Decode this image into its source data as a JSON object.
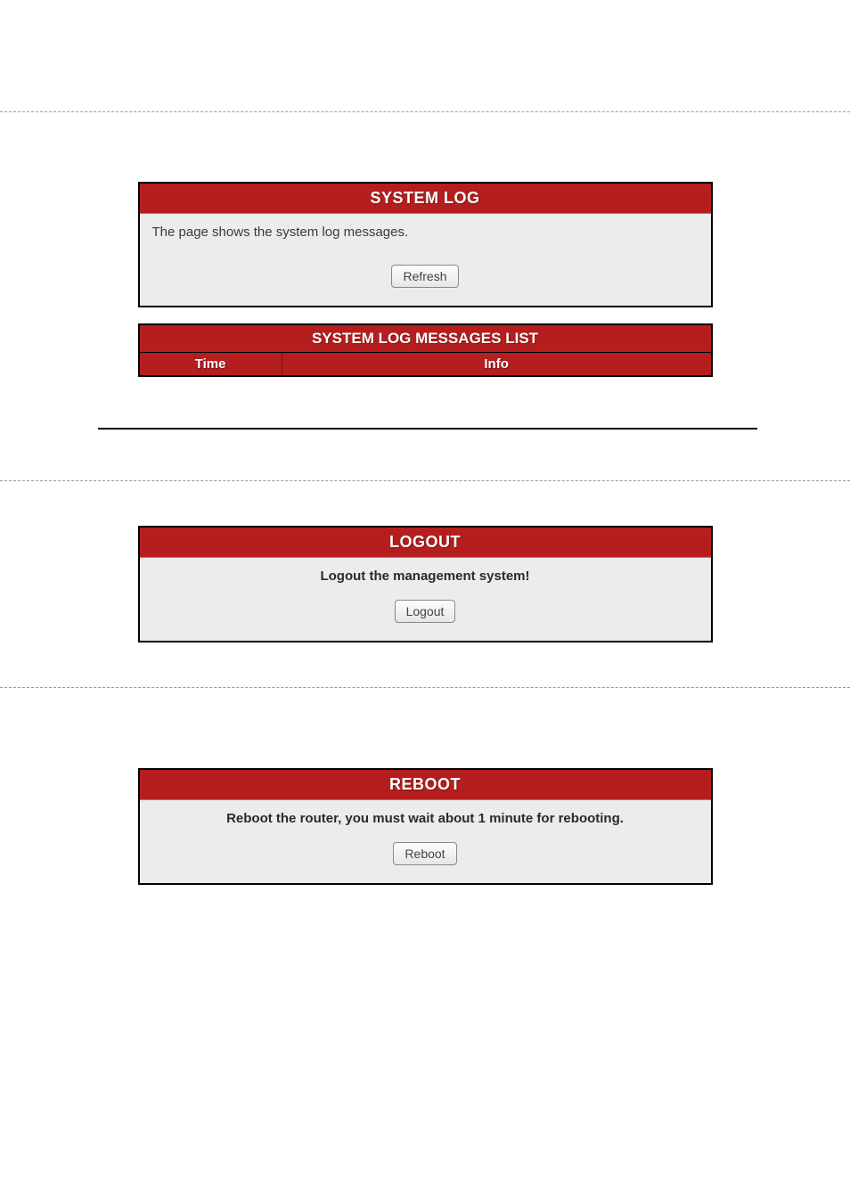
{
  "system_log": {
    "title": "SYSTEM LOG",
    "description": "The page shows the system log messages.",
    "refresh_button": "Refresh"
  },
  "messages_table": {
    "title": "SYSTEM LOG MESSAGES LIST",
    "columns": {
      "time": "Time",
      "info": "Info"
    },
    "rows": []
  },
  "logout": {
    "title": "LOGOUT",
    "description": "Logout the management system!",
    "button": "Logout"
  },
  "reboot": {
    "title": "REBOOT",
    "description": "Reboot the router, you must wait about 1 minute for rebooting.",
    "button": "Reboot"
  },
  "colors": {
    "header_bg": "#b41e1e",
    "panel_bg": "#ececec"
  }
}
